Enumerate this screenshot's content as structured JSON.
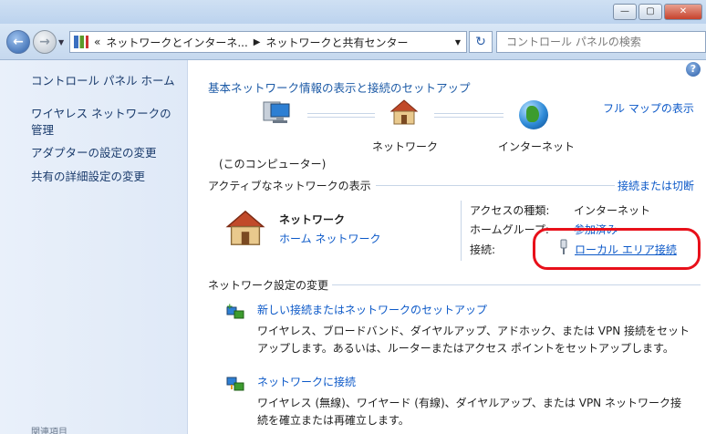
{
  "search": {
    "placeholder": "コントロール パネルの検索"
  },
  "breadcrumb": {
    "chevron": "«",
    "part1": "ネットワークとインターネ...",
    "part2": "ネットワークと共有センター"
  },
  "window": {
    "minimize": "—",
    "maximize": "▢",
    "close": "✕"
  },
  "sidebar": {
    "items": [
      {
        "label": "コントロール パネル ホーム"
      },
      {
        "label": "ワイヤレス ネットワークの管理"
      },
      {
        "label": "アダプターの設定の変更"
      },
      {
        "label": "共有の詳細設定の変更"
      },
      {
        "label": "関連項目"
      }
    ]
  },
  "main": {
    "title": "基本ネットワーク情報の表示と接続のセットアップ",
    "full_map": "フル マップの表示",
    "map": {
      "computer": "(このコンピューター)",
      "network": "ネットワーク",
      "internet": "インターネット"
    },
    "active": {
      "section_title": "アクティブなネットワークの表示",
      "connect_link": "接続または切断",
      "network_name": "ネットワーク",
      "network_type": "ホーム ネットワーク",
      "access_label": "アクセスの種類:",
      "access_value": "インターネット",
      "homegroup_label": "ホームグループ:",
      "homegroup_value": "参加済み",
      "connection_label": "接続:",
      "connection_value": "ローカル エリア接続"
    },
    "settings": {
      "section_title": "ネットワーク設定の変更",
      "items": [
        {
          "title": "新しい接続またはネットワークのセットアップ",
          "desc1": "ワイヤレス、ブロードバンド、ダイヤルアップ、アドホック、または VPN 接続をセット",
          "desc2": "アップします。あるいは、ルーターまたはアクセス ポイントをセットアップします。"
        },
        {
          "title": "ネットワークに接続",
          "desc1": "ワイヤレス (無線)、ワイヤード (有線)、ダイヤルアップ、または VPN ネットワーク接",
          "desc2": "続を確立または再確立します。"
        }
      ]
    }
  },
  "colors": {
    "link": "#0c59c8",
    "highlight_box": "#e8101a",
    "sidebar_bg": "#e4ecf8"
  }
}
